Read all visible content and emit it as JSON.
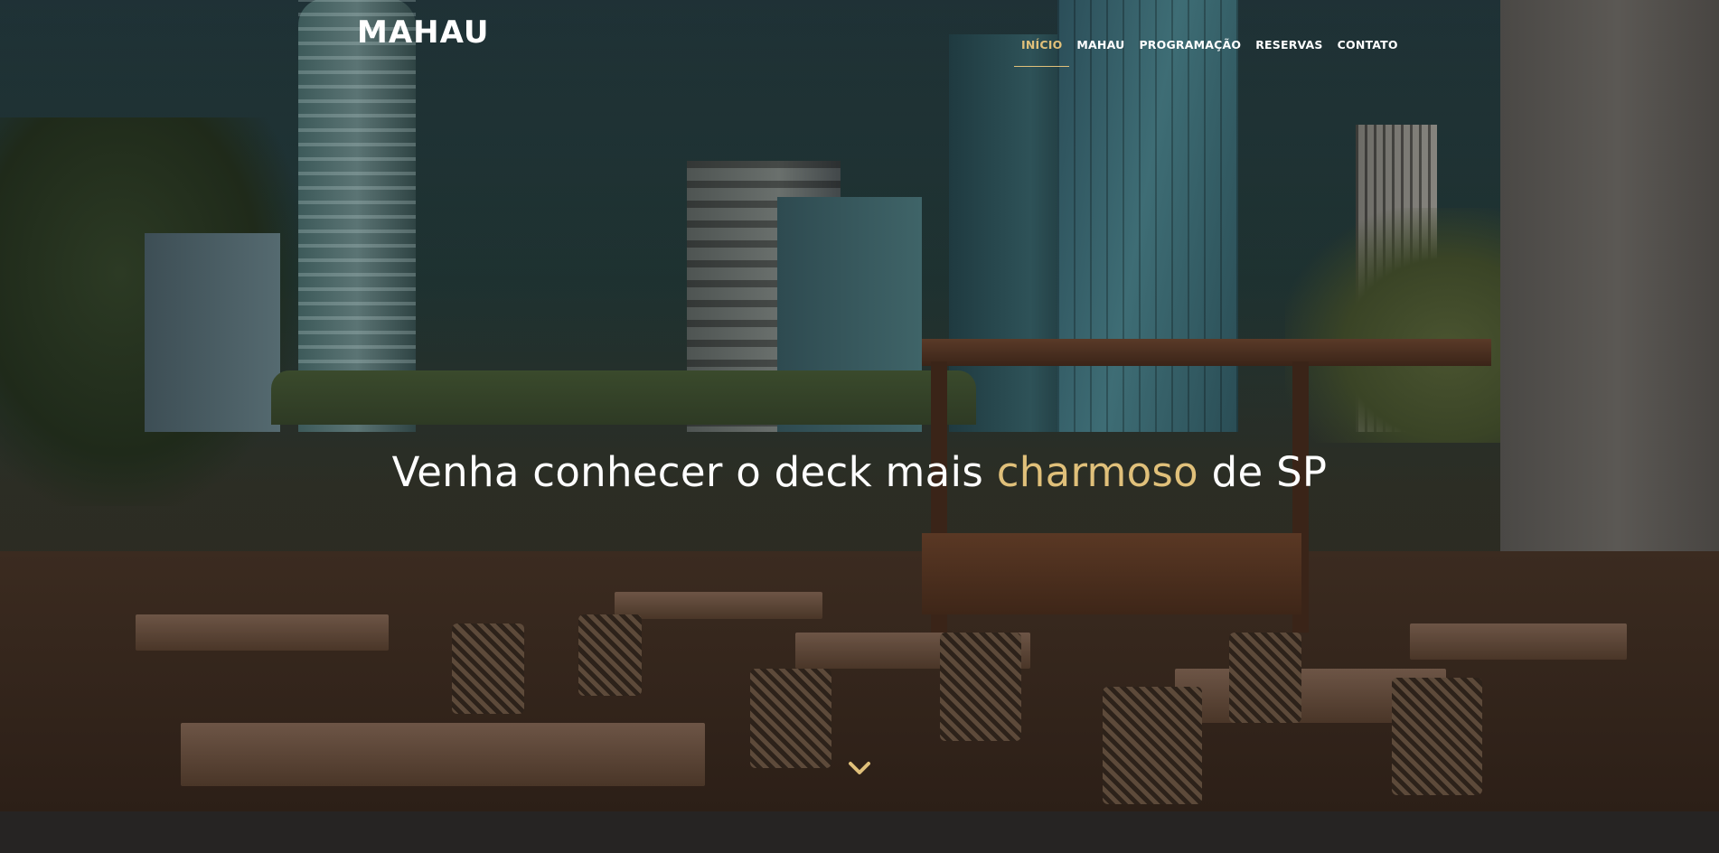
{
  "header": {
    "logo_text": "MAHAU"
  },
  "nav": {
    "items": [
      {
        "label": "INÍCIO",
        "active": true
      },
      {
        "label": "MAHAU",
        "active": false
      },
      {
        "label": "PROGRAMAÇÃO",
        "active": false
      },
      {
        "label": "RESERVAS",
        "active": false
      },
      {
        "label": "CONTATO",
        "active": false
      }
    ]
  },
  "hero": {
    "headline_before": "Venha conhecer o deck mais",
    "headline_accent": "charmoso",
    "headline_after": "de SP",
    "scroll_icon": "chevron-down-icon"
  },
  "colors": {
    "accent": "#e0c07a",
    "text": "#ffffff",
    "footer_strip": "#262423"
  }
}
